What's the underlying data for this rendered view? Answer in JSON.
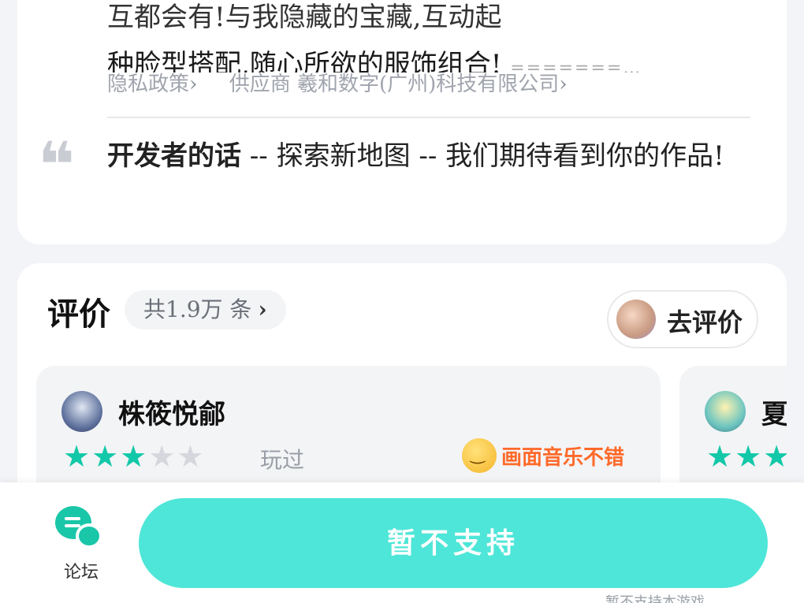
{
  "description": {
    "line1": "互都会有!与我隐藏的宝藏,互动起",
    "line2": "种脸型搭配,随心所欲的服饰组合!",
    "line2_tail": "=======…"
  },
  "links": {
    "privacy": "隐私政策",
    "supplier": "供应商 羲和数字(广州)科技有限公司",
    "chevron": "›"
  },
  "developer": {
    "quote_glyph": "❝",
    "title": "开发者的话",
    "text": " -- 探索新地图 -- 我们期待看到你的作品!"
  },
  "reviews": {
    "title": "评价",
    "count": "共1.9万 条",
    "go_rate": "去评价",
    "items": [
      {
        "user": "株筱悦鄃",
        "rating": 3,
        "played": "玩过",
        "tag": "画面音乐不错"
      },
      {
        "user": "夏",
        "rating": 3
      }
    ]
  },
  "bottom": {
    "forum_label": "论坛",
    "cta": "暂不支持",
    "hint": "暂不支持本游戏..."
  },
  "colors": {
    "accent": "#4ee6d8",
    "star": "#12c8a8",
    "tag": "#ff6a2a"
  }
}
